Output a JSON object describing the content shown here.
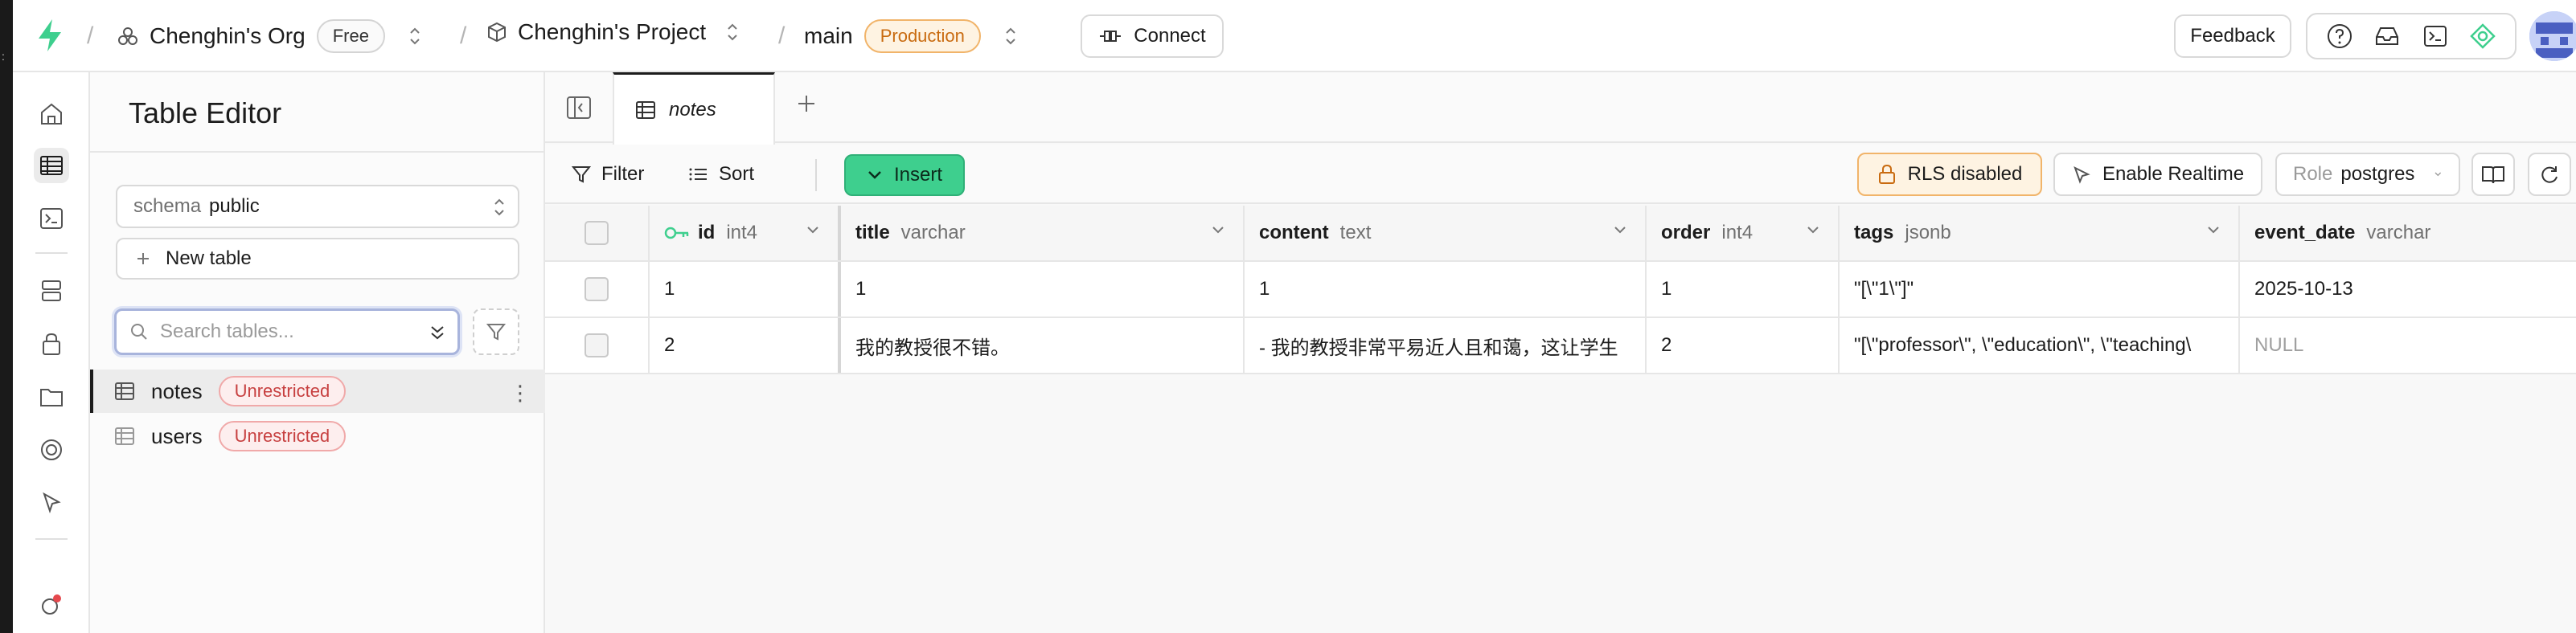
{
  "org": {
    "name": "Chenghin's Org",
    "plan": "Free"
  },
  "project": {
    "name": "Chenghin's Project"
  },
  "branch": {
    "name": "main",
    "env": "Production"
  },
  "header": {
    "connect_label": "Connect",
    "feedback_label": "Feedback"
  },
  "sidebar": {
    "title": "Table Editor",
    "schema_label": "schema",
    "schema_value": "public",
    "new_table_label": "New table",
    "search_placeholder": "Search tables...",
    "tables": [
      {
        "name": "notes",
        "badge": "Unrestricted"
      },
      {
        "name": "users",
        "badge": "Unrestricted"
      }
    ]
  },
  "tabs": [
    {
      "label": "notes"
    }
  ],
  "toolbar": {
    "filter_label": "Filter",
    "sort_label": "Sort",
    "insert_label": "Insert",
    "rls_label": "RLS disabled",
    "realtime_label": "Enable Realtime",
    "role_label": "Role",
    "role_value": "postgres"
  },
  "colors": {
    "accent": "#3ecf8e",
    "warning": "#f1b46a",
    "danger": "#c74040"
  },
  "grid": {
    "columns": [
      {
        "name": "id",
        "type": "int4",
        "primary_key": true
      },
      {
        "name": "title",
        "type": "varchar"
      },
      {
        "name": "content",
        "type": "text"
      },
      {
        "name": "order",
        "type": "int4"
      },
      {
        "name": "tags",
        "type": "jsonb"
      },
      {
        "name": "event_date",
        "type": "varchar"
      }
    ],
    "rows": [
      [
        "1",
        "1",
        "1",
        "1",
        "\"[\\\"1\\\"]\"",
        "2025-10-13"
      ],
      [
        "2",
        "我的教授很不错。",
        "- 我的教授非常平易近人且和蔼，这让学生",
        "2",
        "\"[\\\"professor\\\", \\\"education\\\", \\\"teaching\\",
        "NULL"
      ]
    ]
  }
}
